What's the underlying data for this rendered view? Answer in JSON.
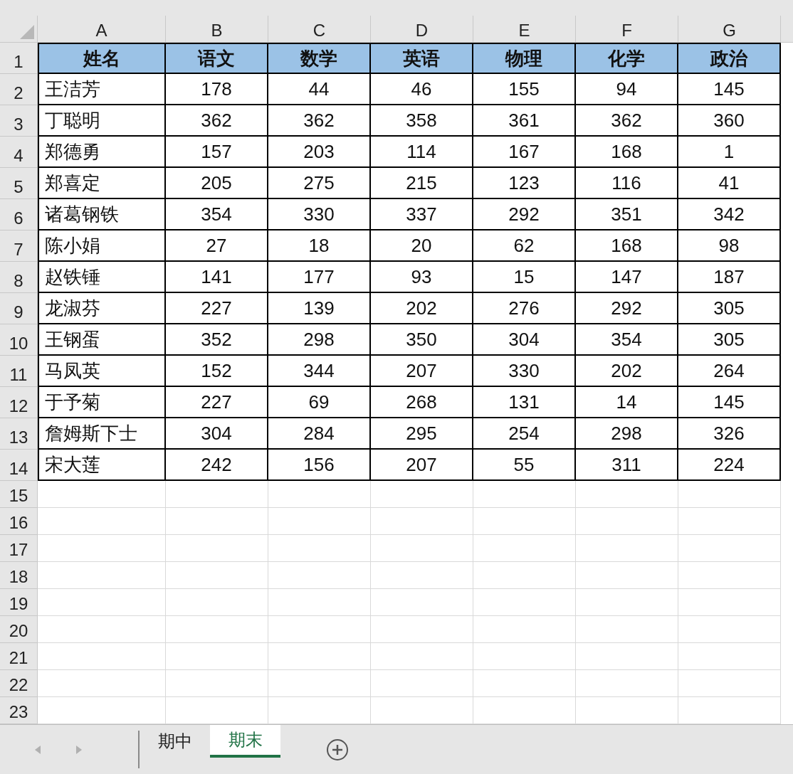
{
  "columns": [
    "A",
    "B",
    "C",
    "D",
    "E",
    "F",
    "G"
  ],
  "rows": [
    {
      "number": "1",
      "kind": "header",
      "cells": [
        "姓名",
        "语文",
        "数学",
        "英语",
        "物理",
        "化学",
        "政治"
      ]
    },
    {
      "number": "2",
      "kind": "data",
      "cells": [
        "王洁芳",
        "178",
        "44",
        "46",
        "155",
        "94",
        "145"
      ]
    },
    {
      "number": "3",
      "kind": "data",
      "cells": [
        "丁聪明",
        "362",
        "362",
        "358",
        "361",
        "362",
        "360"
      ]
    },
    {
      "number": "4",
      "kind": "data",
      "cells": [
        "郑德勇",
        "157",
        "203",
        "114",
        "167",
        "168",
        "1"
      ]
    },
    {
      "number": "5",
      "kind": "data",
      "cells": [
        "郑喜定",
        "205",
        "275",
        "215",
        "123",
        "116",
        "41"
      ]
    },
    {
      "number": "6",
      "kind": "data",
      "cells": [
        "诸葛钢铁",
        "354",
        "330",
        "337",
        "292",
        "351",
        "342"
      ]
    },
    {
      "number": "7",
      "kind": "data",
      "cells": [
        "陈小娟",
        "27",
        "18",
        "20",
        "62",
        "168",
        "98"
      ]
    },
    {
      "number": "8",
      "kind": "data",
      "cells": [
        "赵铁锤",
        "141",
        "177",
        "93",
        "15",
        "147",
        "187"
      ]
    },
    {
      "number": "9",
      "kind": "data",
      "cells": [
        "龙淑芬",
        "227",
        "139",
        "202",
        "276",
        "292",
        "305"
      ]
    },
    {
      "number": "10",
      "kind": "data",
      "cells": [
        "王钢蛋",
        "352",
        "298",
        "350",
        "304",
        "354",
        "305"
      ]
    },
    {
      "number": "11",
      "kind": "data",
      "cells": [
        "马凤英",
        "152",
        "344",
        "207",
        "330",
        "202",
        "264"
      ]
    },
    {
      "number": "12",
      "kind": "data",
      "cells": [
        "于予菊",
        "227",
        "69",
        "268",
        "131",
        "14",
        "145"
      ]
    },
    {
      "number": "13",
      "kind": "data",
      "cells": [
        "詹姆斯下士",
        "304",
        "284",
        "295",
        "254",
        "298",
        "326"
      ]
    },
    {
      "number": "14",
      "kind": "data",
      "cells": [
        "宋大莲",
        "242",
        "156",
        "207",
        "55",
        "311",
        "224"
      ]
    }
  ],
  "empty_rows": [
    "15",
    "16",
    "17",
    "18",
    "19",
    "20",
    "21",
    "22",
    "23"
  ],
  "sheet_tabs": [
    {
      "label": "期中",
      "selected": false
    },
    {
      "label": "期末",
      "selected": true
    }
  ]
}
